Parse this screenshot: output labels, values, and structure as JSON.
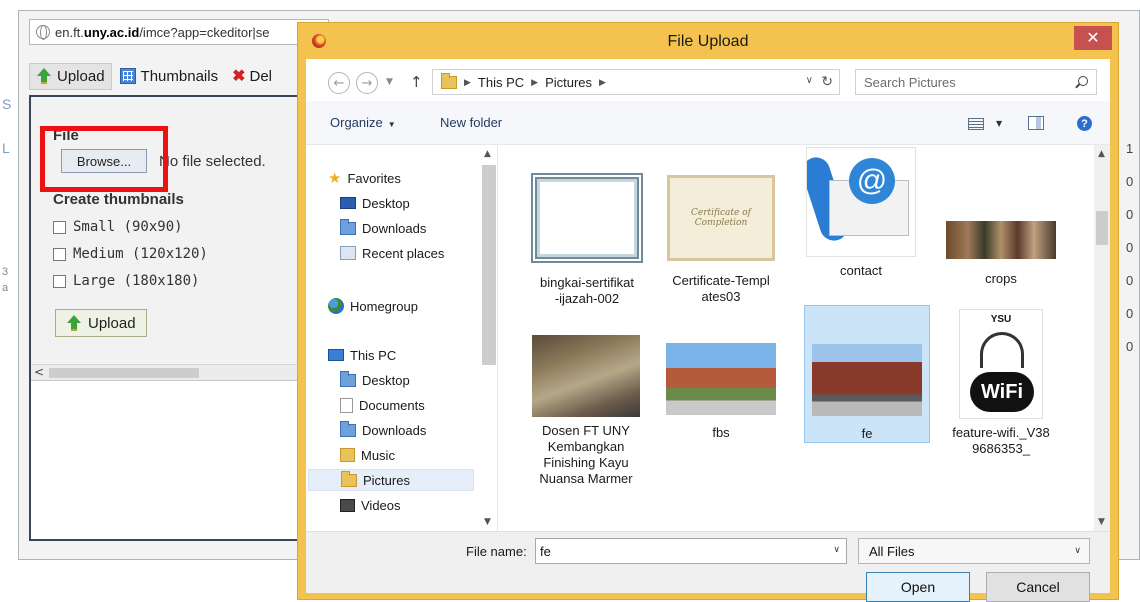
{
  "browser": {
    "url_prefix": "en.ft.",
    "url_domain": "uny.ac.id",
    "url_suffix": "/imce?app=ckeditor|se"
  },
  "imce": {
    "toolbar": {
      "upload_label": "Upload",
      "thumbnails_label": "Thumbnails",
      "delete_label": "Del"
    },
    "upload_form": {
      "file_label": "File",
      "browse_label": "Browse...",
      "file_status": "No file selected.",
      "thumbnails_heading": "Create thumbnails",
      "options": [
        {
          "label": "Small (90x90)",
          "checked": false
        },
        {
          "label": "Medium (120x120)",
          "checked": false
        },
        {
          "label": "Large (180x180)",
          "checked": false
        }
      ],
      "submit_label": "Upload"
    },
    "left_glyphs": [
      "S",
      "L",
      "3",
      "a"
    ],
    "right_digits": [
      "1",
      "0",
      "0",
      "0",
      "0",
      "0",
      "0"
    ]
  },
  "dialog": {
    "title": "File Upload",
    "close_glyph": "✕",
    "nav": {
      "back_glyph": "←",
      "forward_glyph": "→",
      "up_glyph": "↑",
      "breadcrumb": [
        "This PC",
        "Pictures"
      ]
    },
    "search": {
      "placeholder": "Search Pictures"
    },
    "commands": {
      "organize_label": "Organize",
      "new_folder_label": "New folder",
      "help_glyph": "?"
    },
    "navigation_pane": {
      "favorites_label": "Favorites",
      "favorites": [
        "Desktop",
        "Downloads",
        "Recent places"
      ],
      "homegroup_label": "Homegroup",
      "this_pc_label": "This PC",
      "this_pc_items": [
        "Desktop",
        "Documents",
        "Downloads",
        "Music",
        "Pictures",
        "Videos"
      ],
      "selected": "Pictures"
    },
    "files": [
      {
        "name": "bingkai-sertifikat-ijazah-002",
        "line1": "bingkai-sertifikat",
        "line2": "-ijazah-002",
        "icon": "certificate-frame-thumbnail"
      },
      {
        "name": "Certificate-Templates03",
        "line1": "Certificate-Templ",
        "line2": "ates03",
        "icon": "certificate-template-thumbnail",
        "thumb_text": "Certificate of Completion"
      },
      {
        "name": "contact",
        "line1": "contact",
        "line2": "",
        "icon": "contact-email-thumbnail"
      },
      {
        "name": "crops",
        "line1": "crops",
        "line2": "",
        "icon": "group-photo-thumbnail"
      },
      {
        "name": "Dosen FT UNY Kembangkan Finishing Kayu Nuansa Marmer",
        "lines": [
          "Dosen FT UNY",
          "Kembangkan",
          "Finishing Kayu",
          "Nuansa Marmer"
        ],
        "icon": "workshop-photo-thumbnail"
      },
      {
        "name": "fbs",
        "line1": "fbs",
        "line2": "",
        "icon": "building-photo-thumbnail"
      },
      {
        "name": "fe",
        "line1": "fe",
        "line2": "",
        "icon": "building-photo-thumbnail",
        "selected": true
      },
      {
        "name": "feature-wifi._V389686353_",
        "line1": "feature-wifi._V38",
        "line2": "9686353_",
        "icon": "wifi-logo-thumbnail",
        "thumb_brand": "YSU",
        "thumb_badge": "WiFi"
      }
    ],
    "bottom": {
      "filename_label": "File name:",
      "filename_value": "fe",
      "filter_selected": "All Files",
      "open_label": "Open",
      "cancel_label": "Cancel"
    },
    "colors": {
      "title_bar": "#f4c34f",
      "close_button": "#c75050",
      "selection": "#cce4f7",
      "highlight_box": "#ee1111"
    }
  }
}
